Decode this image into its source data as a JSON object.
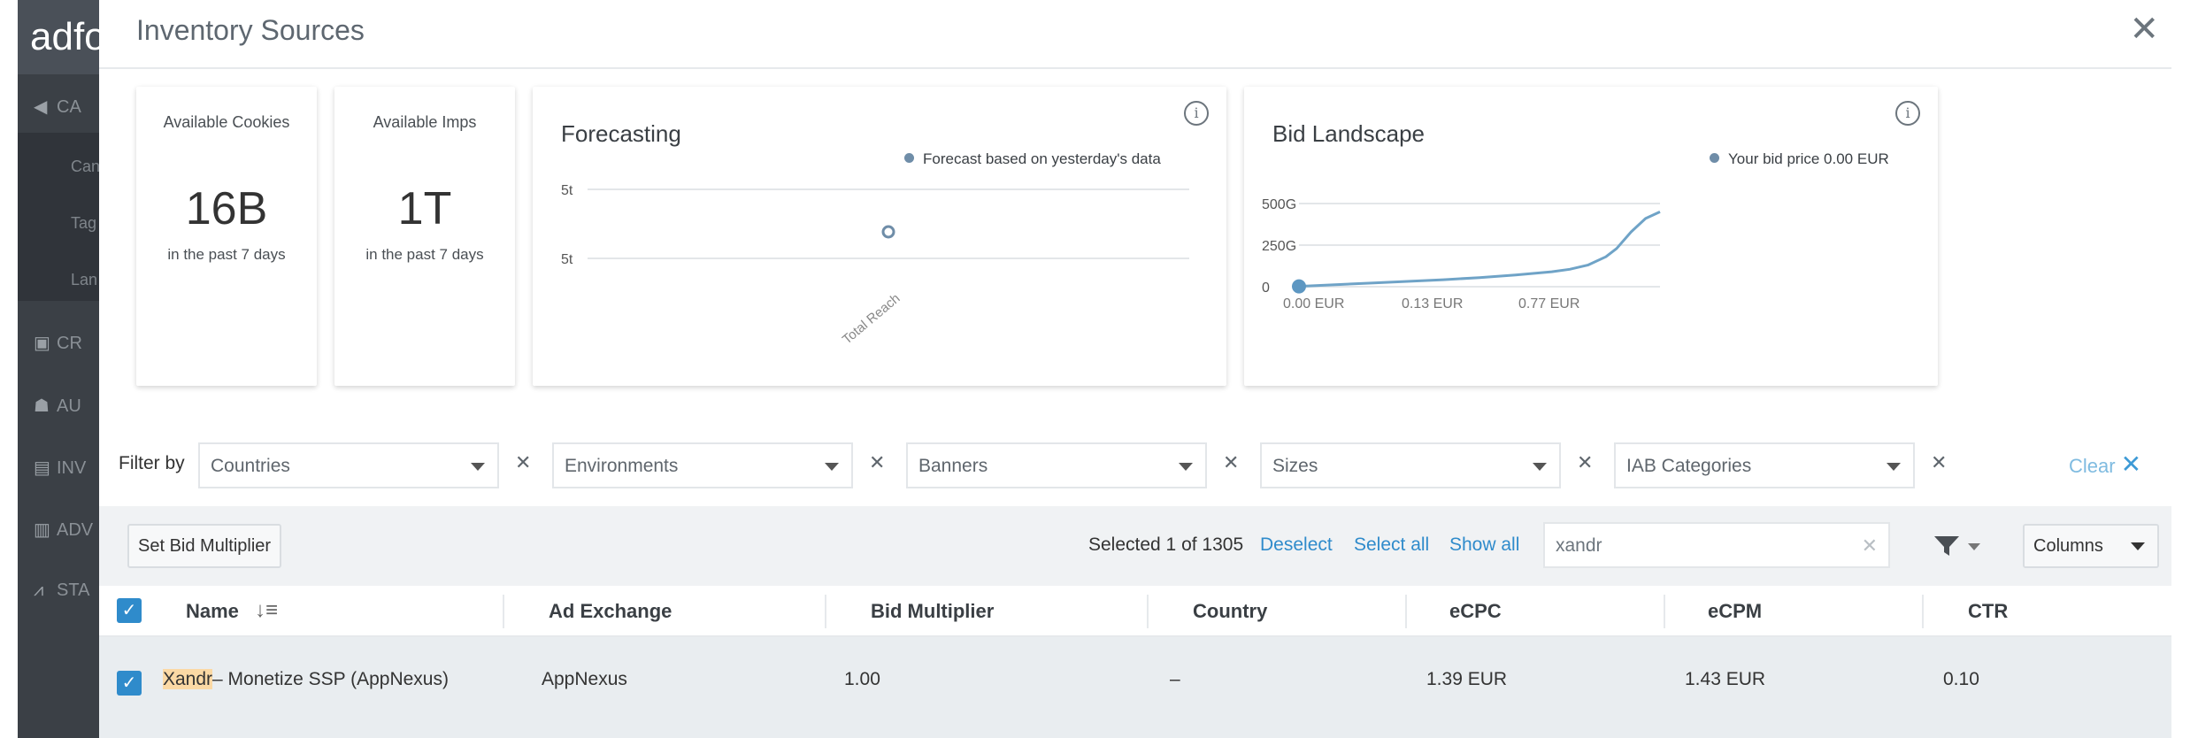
{
  "app": {
    "logo_text": "adfo",
    "sidebar": [
      {
        "icon": "megaphone-icon",
        "glyph": "📢",
        "label": "CA"
      },
      {
        "icon": "image-icon",
        "glyph": "▣",
        "label": "CR"
      },
      {
        "icon": "audience-icon",
        "glyph": "☗",
        "label": "AU"
      },
      {
        "icon": "document-icon",
        "glyph": "▤",
        "label": "INV"
      },
      {
        "icon": "advertiser-icon",
        "glyph": "▥",
        "label": "ADV"
      },
      {
        "icon": "stats-icon",
        "glyph": "⩘",
        "label": "STA"
      }
    ],
    "sidebar_sub": [
      "Can",
      "Tag",
      "Lan"
    ]
  },
  "modal": {
    "title": "Inventory Sources",
    "close": "✕"
  },
  "stats": [
    {
      "label": "Available Cookies",
      "value": "16B",
      "sub": "in the past 7 days"
    },
    {
      "label": "Available Imps",
      "value": "1T",
      "sub": "in the past 7 days"
    }
  ],
  "forecasting": {
    "title": "Forecasting",
    "info": "i",
    "legend": "Forecast based on yesterday's data"
  },
  "bid_landscape": {
    "title": "Bid Landscape",
    "info": "i",
    "legend": "Your bid price 0.00 EUR"
  },
  "chart_data": [
    {
      "type": "scatter",
      "title": "Forecasting",
      "y_tick_labels": [
        "5t",
        "5t"
      ],
      "categories": [
        "Total Reach"
      ],
      "series": [
        {
          "name": "Forecast based on yesterday's data",
          "values": [
            5
          ]
        }
      ],
      "color": "#6f8da8"
    },
    {
      "type": "line",
      "title": "Bid Landscape",
      "y_tick_labels": [
        "500G",
        "250G",
        "0"
      ],
      "x_tick_labels": [
        "0.00 EUR",
        "0.13 EUR",
        "0.77 EUR"
      ],
      "ylim": [
        0,
        500
      ],
      "x": [
        0,
        0.1,
        0.2,
        0.3,
        0.4,
        0.5,
        0.6,
        0.7,
        0.75,
        0.8,
        0.85,
        0.88,
        0.92,
        0.96,
        1.0
      ],
      "y": [
        2,
        12,
        22,
        32,
        42,
        55,
        70,
        90,
        105,
        130,
        180,
        230,
        330,
        410,
        450
      ],
      "marker": {
        "name": "Your bid price 0.00 EUR",
        "x": 0,
        "y": 2
      },
      "color": "#6fa3c7"
    }
  ],
  "filters": {
    "label": "Filter by",
    "items": [
      {
        "placeholder": "Countries"
      },
      {
        "placeholder": "Environments"
      },
      {
        "placeholder": "Banners"
      },
      {
        "placeholder": "Sizes"
      },
      {
        "placeholder": "IAB Categories"
      }
    ],
    "remove": "✕",
    "clear_label": "Clear",
    "clear_icon": "✕"
  },
  "toolbar": {
    "set_bid_multiplier": "Set Bid Multiplier",
    "selected_info": "Selected 1 of 1305",
    "deselect": "Deselect",
    "select_all": "Select all",
    "show_all": "Show all",
    "search_value": "xandr",
    "search_clear": "✕",
    "filter_icon": "⏷",
    "columns": "Columns"
  },
  "table": {
    "columns": [
      "Name",
      "Ad Exchange",
      "Bid Multiplier",
      "Country",
      "eCPC",
      "eCPM",
      "CTR"
    ],
    "rows": [
      {
        "name_highlight": "Xandr",
        "name_rest": "– Monetize SSP (AppNexus)",
        "ad_exchange": "AppNexus",
        "bid_multiplier": "1.00",
        "country": "–",
        "ecpc": "1.39 EUR",
        "ecpm": "1.43 EUR",
        "ctr": "0.10"
      }
    ]
  }
}
